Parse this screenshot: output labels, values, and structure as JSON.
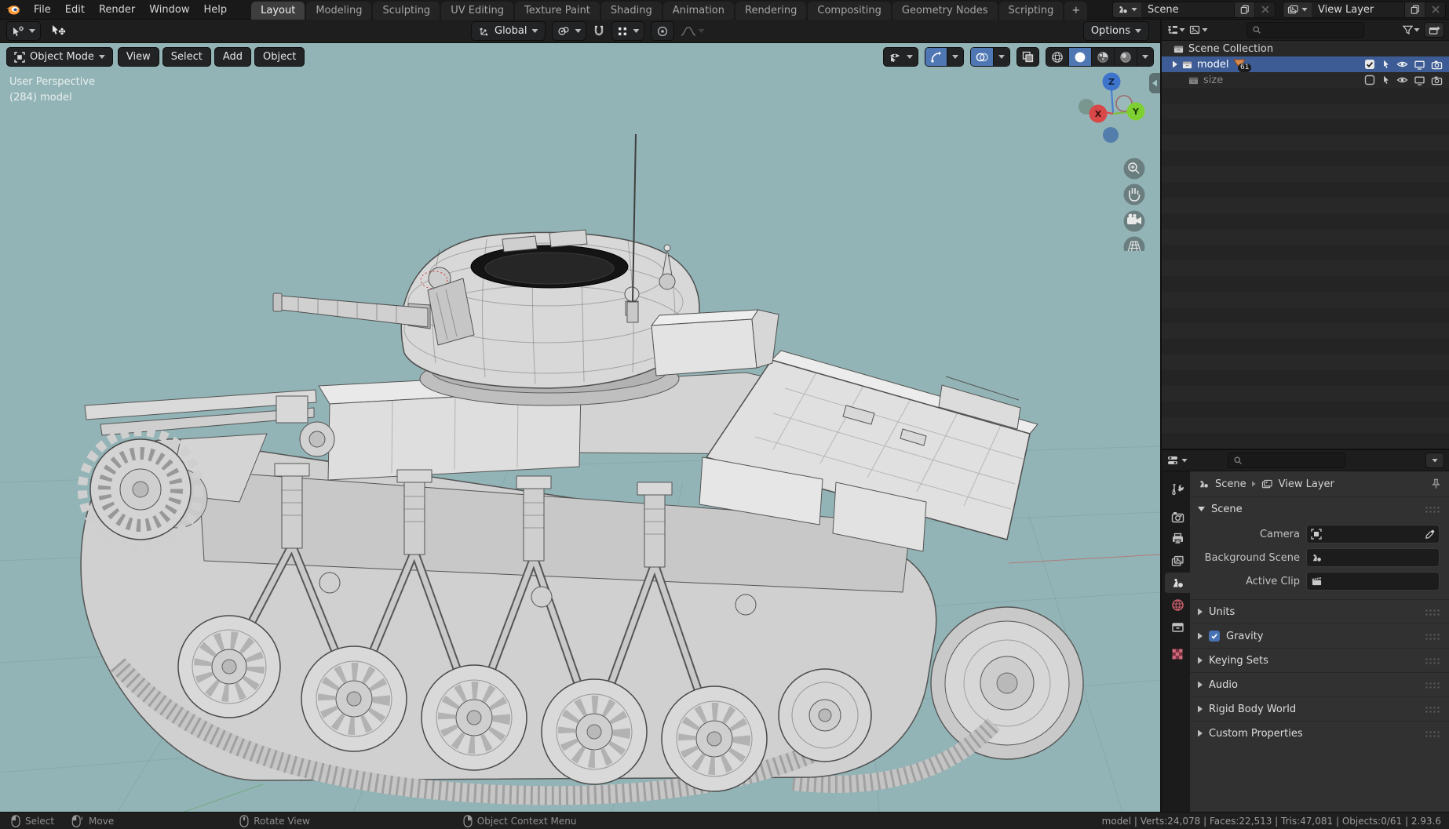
{
  "colors": {
    "viewport_bg": "#93b4b6",
    "accent_blue": "#4772b3",
    "selection_blue": "#3d5c96",
    "badge_orange": "#df813a"
  },
  "topbar": {
    "menus": [
      "File",
      "Edit",
      "Render",
      "Window",
      "Help"
    ],
    "workspaces": [
      "Layout",
      "Modeling",
      "Sculpting",
      "UV Editing",
      "Texture Paint",
      "Shading",
      "Animation",
      "Rendering",
      "Compositing",
      "Geometry Nodes",
      "Scripting"
    ],
    "active_workspace": "Layout",
    "add_workspace": "+",
    "scene_selector": {
      "label": "Scene"
    },
    "view_layer_selector": {
      "label": "View Layer"
    }
  },
  "tool_settings": {
    "orientation": "Global",
    "options": "Options"
  },
  "viewport": {
    "mode": "Object Mode",
    "menus": [
      "View",
      "Select",
      "Add",
      "Object"
    ],
    "overlay": {
      "line1": "User Perspective",
      "line2": "(284) model"
    },
    "axes": {
      "x": "X",
      "y": "Y",
      "z": "Z"
    }
  },
  "outliner": {
    "root": "Scene Collection",
    "collections": [
      {
        "label": "model",
        "selected": true,
        "badge": "61",
        "checkbox": true
      },
      {
        "label": "size",
        "selected": false,
        "checkbox": false
      }
    ],
    "row_icons": [
      "checkbox",
      "cursor",
      "eye",
      "monitor",
      "camera"
    ]
  },
  "properties": {
    "tabs": [
      "tool",
      "render",
      "output",
      "view-layer",
      "scene",
      "world",
      "collection",
      "texture"
    ],
    "active_tab": "scene",
    "breadcrumb": {
      "scene": "Scene",
      "view_layer": "View Layer"
    },
    "scene_panel": {
      "title": "Scene",
      "fields": [
        {
          "label": "Camera"
        },
        {
          "label": "Background Scene"
        },
        {
          "label": "Active Clip"
        }
      ]
    },
    "collapsed_panels": [
      {
        "label": "Units"
      },
      {
        "label": "Gravity",
        "checkbox": true
      },
      {
        "label": "Keying Sets"
      },
      {
        "label": "Audio"
      },
      {
        "label": "Rigid Body World"
      },
      {
        "label": "Custom Properties"
      }
    ]
  },
  "statusbar": {
    "hints": [
      {
        "label": "Select",
        "button": "lmb"
      },
      {
        "label": "Move",
        "button": "lmb-drag"
      },
      {
        "label": "Rotate View",
        "button": "mmb"
      },
      {
        "label": "Object Context Menu",
        "button": "rmb"
      }
    ],
    "stats": "model | Verts:24,078 | Faces:22,513 | Tris:47,081 | Objects:0/61 | 2.93.6"
  }
}
